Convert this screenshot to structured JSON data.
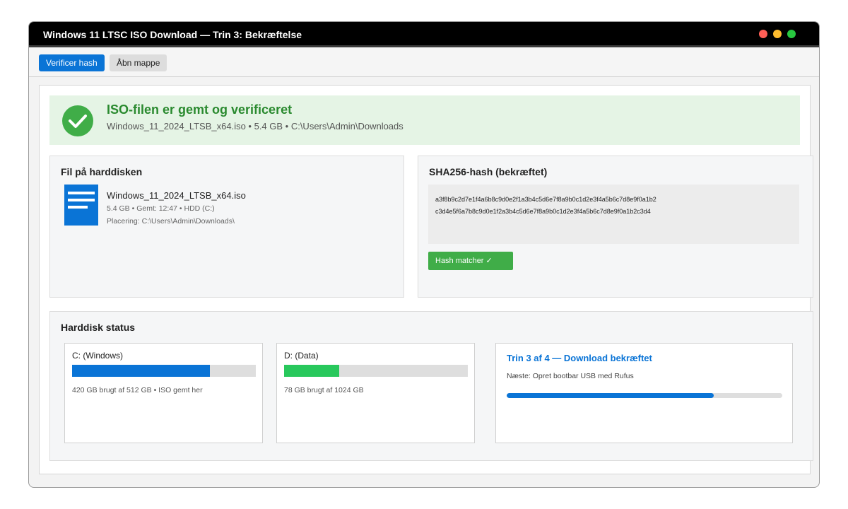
{
  "window": {
    "title": "Windows 11 LTSC ISO Download — Trin 3: Bekræftelse",
    "controls": {
      "close_color": "#ff5f57",
      "minimize_color": "#febc2e",
      "maximize_color": "#28c840"
    }
  },
  "toolbar": {
    "verify_label": "Verificer hash",
    "open_folder_label": "Åbn mappe"
  },
  "banner": {
    "icon": "check-icon",
    "title": "ISO-filen er gemt og verificeret",
    "subtitle": "Windows_11_2024_LTSB_x64.iso • 5.4 GB • C:\\Users\\Admin\\Downloads"
  },
  "file_panel": {
    "title": "Fil på harddisken",
    "icon": "document-icon",
    "file_name": "Windows_11_2024_LTSB_x64.iso",
    "meta": "5.4 GB • Gemt: 12:47 • HDD (C:)",
    "location": "Placering: C:\\Users\\Admin\\Downloads\\"
  },
  "hash_panel": {
    "title": "SHA256-hash (bekræftet)",
    "hash_line1": "a3f8b9c2d7e1f4a6b8c9d0e2f1a3b4c5d6e7f8a9b0c1d2e3f4a5b6c7d8e9f0a1b2",
    "hash_line2": "c3d4e5f6a7b8c9d0e1f2a3b4c5d6e7f8a9b0c1d2e3f4a5b6c7d8e9f0a1b2c3d4",
    "badge": "Hash matcher ✓"
  },
  "disk_status": {
    "title": "Harddisk status",
    "drives": [
      {
        "label": "C: (Windows)",
        "used_fraction": 0.75,
        "color": "#0a74d6",
        "meta": "420 GB brugt af 512 GB • ISO gemt her"
      },
      {
        "label": "D: (Data)",
        "used_fraction": 0.3,
        "color": "#28c85c",
        "meta": "78 GB brugt af 1024 GB"
      }
    ],
    "step": {
      "title": "Trin 3 af 4 — Download bekræftet",
      "next": "Næste: Opret bootbar USB med Rufus",
      "progress_fraction": 0.75
    }
  }
}
